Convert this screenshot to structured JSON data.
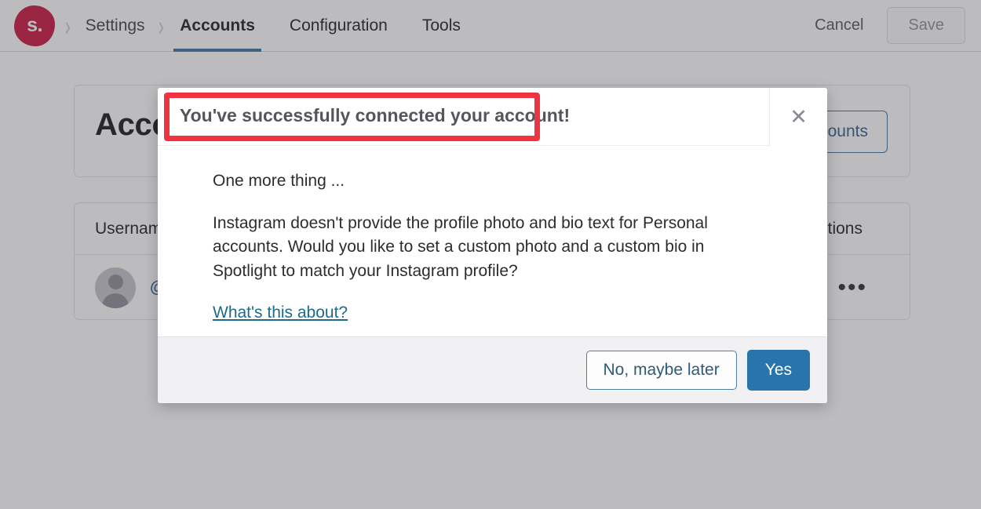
{
  "header": {
    "logo_text": "s.",
    "logo_color": "#c9133e",
    "breadcrumb": "Settings",
    "tabs": [
      {
        "label": "Accounts",
        "active": true
      },
      {
        "label": "Configuration",
        "active": false
      },
      {
        "label": "Tools",
        "active": false
      }
    ],
    "cancel_label": "Cancel",
    "save_label": "Save",
    "active_tab_underline_color": "#3f6e9e"
  },
  "accounts_card": {
    "title": "Accounts",
    "connect_button_label": "Connect accounts"
  },
  "accounts_table": {
    "columns": [
      "Username",
      "Actions"
    ],
    "rows": [
      {
        "username": "@c",
        "actions_glyph": "•••"
      }
    ]
  },
  "modal": {
    "title": "You've successfully connected your account!",
    "title_highlight_color": "#ef3340",
    "close_icon": "✕",
    "intro": "One more thing ...",
    "body": "Instagram doesn't provide the profile photo and bio text for Personal accounts. Would you like to set a custom photo and a custom bio in Spotlight to match your Instagram profile?",
    "link_label": "What's this about?",
    "secondary_button_label": "No, maybe later",
    "primary_button_label": "Yes",
    "primary_button_color": "#2874ab"
  }
}
